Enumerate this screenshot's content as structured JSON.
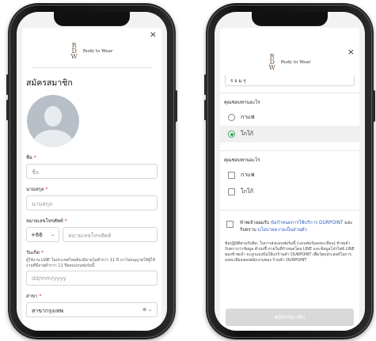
{
  "brand": {
    "monogram": "R\nD\nW",
    "name": "Rudy to Wear"
  },
  "close_glyph": "×",
  "left": {
    "title": "สมัครสมาชิก",
    "name_label": "ชื่อ",
    "name_placeholder": "ชื่อ",
    "surname_label": "นามสกุล",
    "surname_placeholder": "นามสกุล",
    "phone_label": "หมายเลขโทรศัพท์",
    "country_code": "+66",
    "phone_placeholder": "หมายเลขโทรศัพท์",
    "birthday_label": "วันเกิด",
    "birthday_hint": "ผู้ใช้งาน LINE ในประเทศไทยต้องมีอายุไม่ต่ำกว่า 11 ปี เราไม่อนุญาตให้ผู้ใช้งานที่มีอายุต่ำกว่า 11 ปีตอบแบบฟอร์มนี้",
    "birthday_placeholder": "dd/mm/yyyy",
    "branch_label": "สาขา",
    "branch_value": "สาขากรุงเทพ",
    "required_mark": "*"
  },
  "right": {
    "top_field_value": "ร จ ม ๆ",
    "q1": "คุณชอบทานอะไร",
    "q1_options": [
      "กาแฟ",
      "โกโก้"
    ],
    "q2": "คุณชอบทานอะไร",
    "q2_options": [
      "กาแฟ",
      "โกโก้"
    ],
    "consent_prefix": "ข้าพเจ้ายอมรับ",
    "consent_terms": "ข้อกำหนดการใช้บริการ OURPOINT",
    "consent_mid": " และรับทราบ ",
    "consent_policy": "นโยบายความเป็นส่วนตัว",
    "policy_text": "ข้อปฏิบัติตามรับผิด: ในการส่งแบบฟอร์มนี้ (แบบฟอร์มลงทะเบียน) ข้าพเจ้ารับทราบว่าข้อมูล ตัวบ่งชี้ ภายในที่กำหนดโดย LINE และข้อมูลโปรไฟล์ LINE ของข้าพเจ้า จะถูกแบ่งปันให้แก่ร้านค้า OURPOINT เพื่อวัตถุประสงค์ในการลงทะเบียนของพนักงานของ ร้านค้า OURPOINT",
    "submit_label": "สมัครสมาชิก"
  }
}
